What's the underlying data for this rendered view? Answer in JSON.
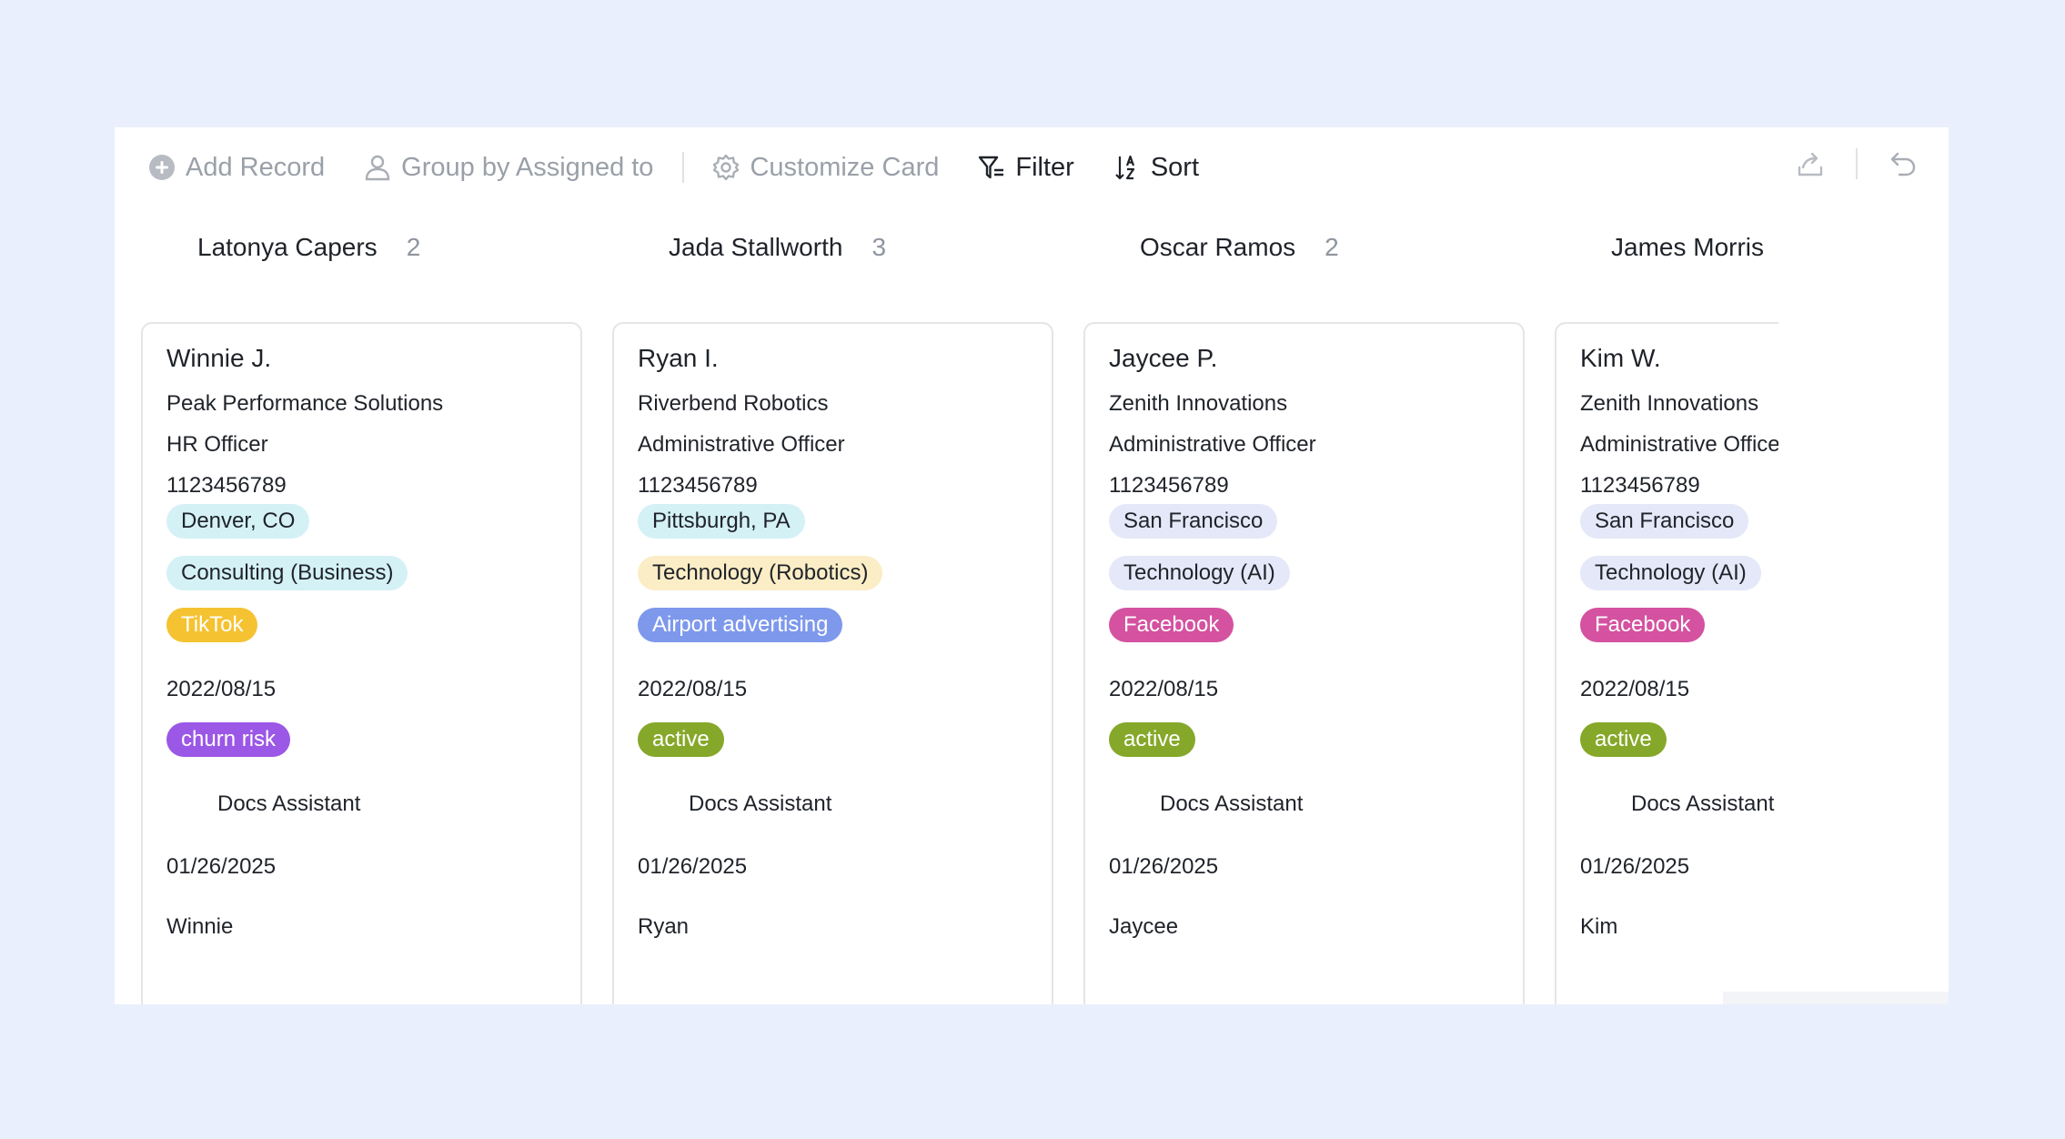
{
  "toolbar": {
    "add_record": "Add Record",
    "group_by": "Group by Assigned to",
    "customize_card": "Customize Card",
    "filter": "Filter",
    "sort": "Sort"
  },
  "icons": {
    "add": "plus-circle-icon",
    "group": "person-icon",
    "customize": "gear-icon",
    "filter": "filter-icon",
    "sort": "sort-icon",
    "share": "share-icon",
    "undo": "undo-icon"
  },
  "colors": {
    "background": "#e9effc",
    "tag_location_teal": "#d4f1f6",
    "tag_location_lavender": "#e4e8f8",
    "tag_industry_teal": "#d4f1f6",
    "tag_industry_yellow": "#fbedc5",
    "tag_industry_lavender": "#e4e8f8",
    "tag_tiktok": "#f5c232",
    "tag_airport": "#7e98ec",
    "tag_facebook": "#d452a0",
    "status_churn": "#9b57e6",
    "status_active": "#86a82a"
  },
  "columns": [
    {
      "header": "Latonya Capers",
      "count": "2",
      "card": {
        "name": "Winnie J.",
        "company": "Peak Performance Solutions",
        "title": "HR Officer",
        "phone": "1123456789",
        "location": "Denver, CO",
        "industry": "Consulting (Business)",
        "channel": "TikTok",
        "date": "2022/08/15",
        "status": "churn risk",
        "assistant": "Docs Assistant",
        "created": "01/26/2025",
        "first_name": "Winnie"
      }
    },
    {
      "header": "Jada Stallworth",
      "count": "3",
      "card": {
        "name": "Ryan I.",
        "company": "Riverbend Robotics",
        "title": "Administrative Officer",
        "phone": "1123456789",
        "location": "Pittsburgh, PA",
        "industry": "Technology (Robotics)",
        "channel": "Airport advertising",
        "date": "2022/08/15",
        "status": "active",
        "assistant": "Docs Assistant",
        "created": "01/26/2025",
        "first_name": "Ryan"
      }
    },
    {
      "header": "Oscar Ramos",
      "count": "2",
      "card": {
        "name": "Jaycee P.",
        "company": "Zenith Innovations",
        "title": "Administrative Officer",
        "phone": "1123456789",
        "location": "San Francisco",
        "industry": "Technology (AI)",
        "channel": "Facebook",
        "date": "2022/08/15",
        "status": "active",
        "assistant": "Docs Assistant",
        "created": "01/26/2025",
        "first_name": "Jaycee"
      }
    },
    {
      "header": "James Morris",
      "count": "",
      "card": {
        "name": "Kim W.",
        "company": "Zenith Innovations",
        "title": "Administrative Office",
        "phone": "1123456789",
        "location": "San Francisco",
        "industry": "Technology (AI)",
        "channel": "Facebook",
        "date": "2022/08/15",
        "status": "active",
        "assistant": "Docs Assistant",
        "created": "01/26/2025",
        "first_name": "Kim"
      }
    }
  ]
}
